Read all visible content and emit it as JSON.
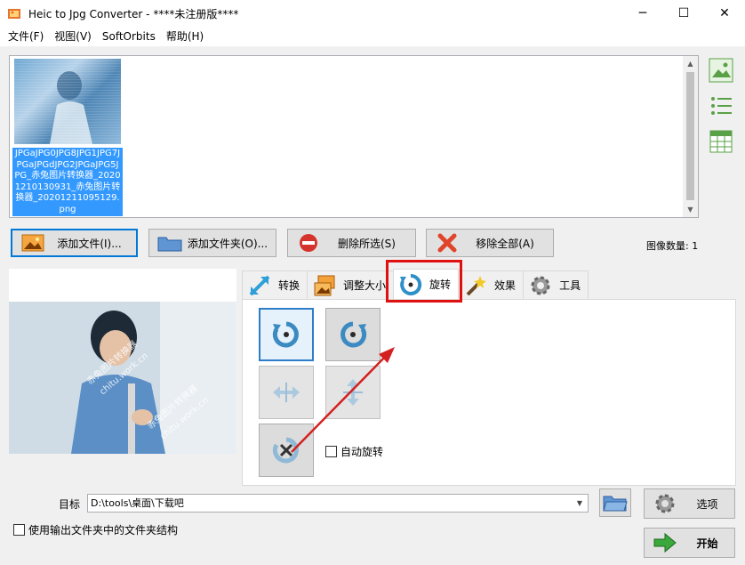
{
  "window": {
    "title": "Heic to Jpg Converter - ****未注册版****",
    "minimize_glyph": "─",
    "maximize_glyph": "☐",
    "close_glyph": "✕"
  },
  "menu": [
    "文件(F)",
    "视图(V)",
    "SoftOrbits",
    "帮助(H)"
  ],
  "thumbnail": {
    "caption": "JPGaJPG0JPG8JPG1JPG7JPGaJPGdJPG2JPGaJPG5JPG_赤兔图片转换器_20201210130931_赤兔图片转换器_20201211095129.png"
  },
  "toolbar": {
    "add_file": "添加文件(I)...",
    "add_folder": "添加文件夹(O)...",
    "delete_selected": "删除所选(S)",
    "remove_all": "移除全部(A)",
    "image_count": "图像数量: 1"
  },
  "preview": {
    "watermark": "赤兔图片转换器",
    "watermark_url": "chitu.work.cn"
  },
  "tabs": [
    "转换",
    "调整大小",
    "旋转",
    "效果",
    "工具"
  ],
  "rotate_panel": {
    "auto_rotate_label": "自动旋转"
  },
  "bottom": {
    "target_label": "目标",
    "target_path": "D:\\tools\\桌面\\下载吧",
    "options_button": "选项",
    "start_button": "开始",
    "keep_structure_label": "使用输出文件夹中的文件夹结构"
  },
  "colors": {
    "accent": "#0078d7",
    "highlight_box": "#e01010",
    "arrow": "#d42020",
    "selection": "#3399ff"
  }
}
